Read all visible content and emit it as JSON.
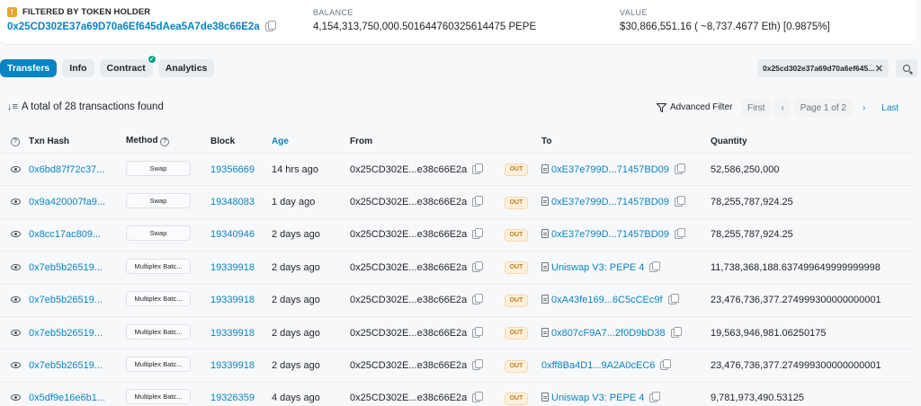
{
  "header": {
    "filter_title": "FILTERED BY TOKEN HOLDER",
    "holder_address": "0x25CD302E37a69D70a6Ef645dAea5A7de38c66E2a",
    "balance_label": "BALANCE",
    "balance_value": "4,154,313,750,000.501644760325614475 PEPE",
    "value_label": "VALUE",
    "value_value": "$30,866,551.16 ( ~8,737.4677 Eth) [0.9875%]"
  },
  "tabs": [
    {
      "label": "Transfers",
      "active": true
    },
    {
      "label": "Info"
    },
    {
      "label": "Contract",
      "verified": true
    },
    {
      "label": "Analytics"
    }
  ],
  "filter_chip": {
    "text": "0x25cd302e37a69d70a6ef645...",
    "close": "✕"
  },
  "summary": {
    "sort_icon": "↓≡",
    "text": "A total of 28 transactions found"
  },
  "advanced_filter": {
    "label": "Advanced Filter"
  },
  "pager": {
    "first": "First",
    "prev": "‹",
    "page": "Page 1 of 2",
    "next": "›",
    "last": "Last"
  },
  "table": {
    "headers": {
      "txn_hash": "Txn Hash",
      "method": "Method",
      "block": "Block",
      "age": "Age",
      "from": "From",
      "to": "To",
      "quantity": "Quantity"
    },
    "rows": [
      {
        "hash": "0x6bd87f72c37...",
        "method": "Swap",
        "block": "19356669",
        "age": "14 hrs ago",
        "from": "0x25CD302E...e38c66E2a",
        "dir": "OUT",
        "to": "0xE37e799D...71457BD09",
        "to_contract": true,
        "to_copy": true,
        "qty": "52,586,250,000"
      },
      {
        "hash": "0x9a420007fa9...",
        "method": "Swap",
        "block": "19348083",
        "age": "1 day ago",
        "from": "0x25CD302E...e38c66E2a",
        "dir": "OUT",
        "to": "0xE37e799D...71457BD09",
        "to_contract": true,
        "to_copy": true,
        "qty": "78,255,787,924.25"
      },
      {
        "hash": "0x8cc17ac809...",
        "method": "Swap",
        "block": "19340946",
        "age": "2 days ago",
        "from": "0x25CD302E...e38c66E2a",
        "dir": "OUT",
        "to": "0xE37e799D...71457BD09",
        "to_contract": true,
        "to_copy": true,
        "qty": "78,255,787,924.25"
      },
      {
        "hash": "0x7eb5b26519...",
        "method": "Multiplex Batc...",
        "block": "19339918",
        "age": "2 days ago",
        "from": "0x25CD302E...e38c66E2a",
        "dir": "OUT",
        "to": "Uniswap V3: PEPE 4",
        "to_contract": true,
        "to_copy": true,
        "qty": "11,738,368,188.637499649999999998"
      },
      {
        "hash": "0x7eb5b26519...",
        "method": "Multiplex Batc...",
        "block": "19339918",
        "age": "2 days ago",
        "from": "0x25CD302E...e38c66E2a",
        "dir": "OUT",
        "to": "0xA43fe169...6C5cCEc9f",
        "to_contract": true,
        "to_copy": true,
        "qty": "23,476,736,377.274999300000000001"
      },
      {
        "hash": "0x7eb5b26519...",
        "method": "Multiplex Batc...",
        "block": "19339918",
        "age": "2 days ago",
        "from": "0x25CD302E...e38c66E2a",
        "dir": "OUT",
        "to": "0x807cF9A7...2f0D9bD38",
        "to_contract": true,
        "to_copy": true,
        "qty": "19,563,946,981.06250175"
      },
      {
        "hash": "0x7eb5b26519...",
        "method": "Multiplex Batc...",
        "block": "19339918",
        "age": "2 days ago",
        "from": "0x25CD302E...e38c66E2a",
        "dir": "OUT",
        "to": "0xff8Ba4D1...9A2A0cEC6",
        "to_contract": false,
        "to_copy": true,
        "qty": "23,476,736,377.274999300000000001"
      },
      {
        "hash": "0x5df9e16e6b1...",
        "method": "Multiplex Batc...",
        "block": "19326359",
        "age": "4 days ago",
        "from": "0x25CD302E...e38c66E2a",
        "dir": "OUT",
        "to": "Uniswap V3: PEPE 4",
        "to_contract": true,
        "to_copy": true,
        "qty": "9,781,973,490.53125"
      }
    ]
  },
  "colors": {
    "link": "#0784c3",
    "out_badge": "#c07e1d",
    "active_tab": "#0784c3"
  }
}
